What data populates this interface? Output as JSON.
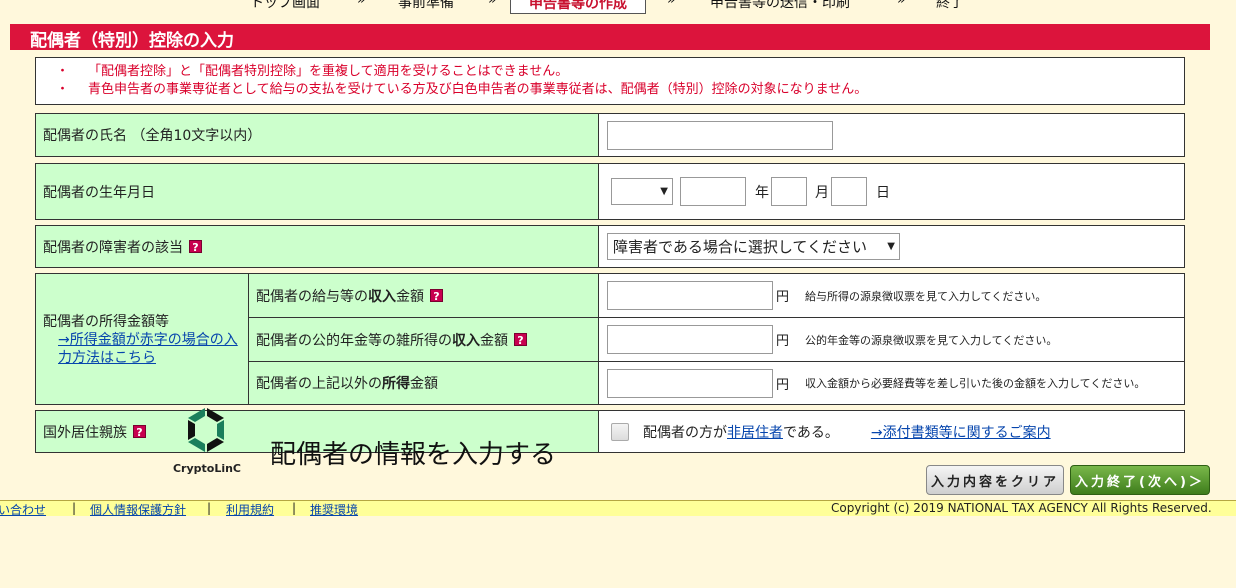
{
  "nav": {
    "steps": [
      "トップ画面",
      "事前準備",
      "申告書等の作成",
      "申告書等の送信・印刷",
      "終了"
    ],
    "arrow": "»"
  },
  "title": "配偶者（特別）控除の入力",
  "notice": {
    "bullet": "・",
    "lines": [
      "「配偶者控除」と「配偶者特別控除」を重複して適用を受けることはできません。",
      "青色申告者の事業専従者として給与の支払を受けている方及び白色申告者の事業専従者は、配偶者（特別）控除の対象になりません。"
    ]
  },
  "form": {
    "name_label": "配偶者の氏名 （全角10文字以内）",
    "name_value": "",
    "birth_label": "配偶者の生年月日",
    "birth_era": "",
    "birth_year": "",
    "birth_month": "",
    "birth_day": "",
    "year_unit": "年",
    "month_unit": "月",
    "day_unit": "日",
    "disability_label": "配偶者の障害者の該当",
    "disability_select": "障害者である場合に選択してください",
    "income_group_label": "配偶者の所得金額等",
    "income_link": "→所得金額が赤字の場合の入力方法はこちら",
    "salary_label_pre": "配偶者の給与等の",
    "salary_label_bold": "収入",
    "salary_label_post": "金額",
    "salary_hint": "給与所得の源泉徴収票を見て入力してください。",
    "pension_label_pre": "配偶者の公的年金等の雑所得の",
    "pension_label_bold": "収入",
    "pension_label_post": "金額",
    "pension_hint": "公的年金等の源泉徴収票を見て入力してください。",
    "other_label_pre": "配偶者の上記以外の",
    "other_label_bold": "所得",
    "other_label_post": "金額",
    "other_hint": "収入金額から必要経費等を差し引いた後の金額を入力してください。",
    "yen": "円",
    "abroad_label": "国外居住親族",
    "nonresident_pre": "配偶者の方が",
    "nonresident_link": "非居住者",
    "nonresident_post": "である。",
    "attach_link": "→添付書類等に関するご案内",
    "help": "?"
  },
  "buttons": {
    "clear": "入力内容をクリア",
    "finish": "入力終了(次へ)＞"
  },
  "footer": {
    "links": [
      "問い合わせ",
      "個人情報保護方針",
      "利用規約",
      "推奨環境"
    ],
    "sep": "|",
    "copyright": "Copyright (c) 2019 NATIONAL TAX AGENCY All Rights Reserved."
  },
  "overlay": {
    "logo_text": "CryptoLinC",
    "caption": "配偶者の情報を入力する"
  },
  "colors": {
    "title_bar": "#dc143c",
    "label_bg": "#ccffcc",
    "page_bg": "#fff8dc",
    "notice_text": "#d9002b"
  }
}
